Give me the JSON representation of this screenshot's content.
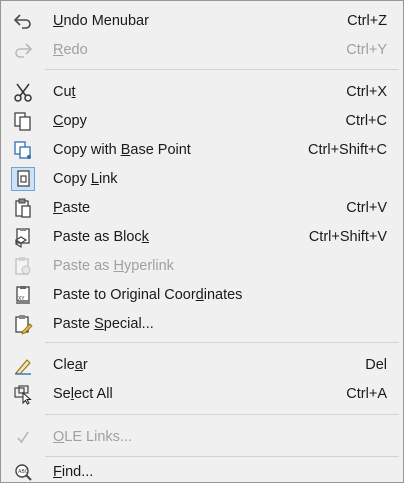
{
  "menu": {
    "items": [
      {
        "label": "Undo Menubar",
        "mnemonic": "U",
        "shortcut": "Ctrl+Z",
        "icon": "undo-icon",
        "disabled": false
      },
      {
        "label": "Redo",
        "mnemonic": "R",
        "shortcut": "Ctrl+Y",
        "icon": "redo-icon",
        "disabled": true
      },
      {
        "label": "Cut",
        "mnemonic": "t",
        "shortcut": "Ctrl+X",
        "icon": "scissors-icon",
        "disabled": false
      },
      {
        "label": "Copy",
        "mnemonic": "C",
        "shortcut": "Ctrl+C",
        "icon": "copy-icon",
        "disabled": false
      },
      {
        "label": "Copy with Base Point",
        "mnemonic": "B",
        "shortcut": "Ctrl+Shift+C",
        "icon": "copy-base-point-icon",
        "disabled": false
      },
      {
        "label": "Copy Link",
        "mnemonic": "L",
        "shortcut": "",
        "icon": "copy-link-icon",
        "disabled": false
      },
      {
        "label": "Paste",
        "mnemonic": "P",
        "shortcut": "Ctrl+V",
        "icon": "paste-icon",
        "disabled": false
      },
      {
        "label": "Paste as Block",
        "mnemonic": "k",
        "shortcut": "Ctrl+Shift+V",
        "icon": "paste-block-icon",
        "disabled": false
      },
      {
        "label": "Paste as Hyperlink",
        "mnemonic": "H",
        "shortcut": "",
        "icon": "paste-hyperlink-icon",
        "disabled": true
      },
      {
        "label": "Paste to Original Coordinates",
        "mnemonic": "d",
        "shortcut": "",
        "icon": "paste-original-icon",
        "disabled": false
      },
      {
        "label": "Paste Special...",
        "mnemonic": "S",
        "shortcut": "",
        "icon": "paste-special-icon",
        "disabled": false
      },
      {
        "label": "Clear",
        "mnemonic": "a",
        "shortcut": "Del",
        "icon": "eraser-icon",
        "disabled": false
      },
      {
        "label": "Select All",
        "mnemonic": "l",
        "shortcut": "Ctrl+A",
        "icon": "select-all-icon",
        "disabled": false
      },
      {
        "label": "OLE Links...",
        "mnemonic": "O",
        "shortcut": "",
        "icon": "checkmark-icon",
        "disabled": true
      },
      {
        "label": "Find...",
        "mnemonic": "F",
        "shortcut": "",
        "icon": "find-icon",
        "disabled": false
      }
    ]
  },
  "colors": {
    "menu_bg": "#f0f0f0",
    "text": "#1a1a1a",
    "disabled_text": "#a0a0a0",
    "highlight_bg": "#cde3f5",
    "highlight_border": "#6aa5d8",
    "separator": "#d2d2d2"
  }
}
